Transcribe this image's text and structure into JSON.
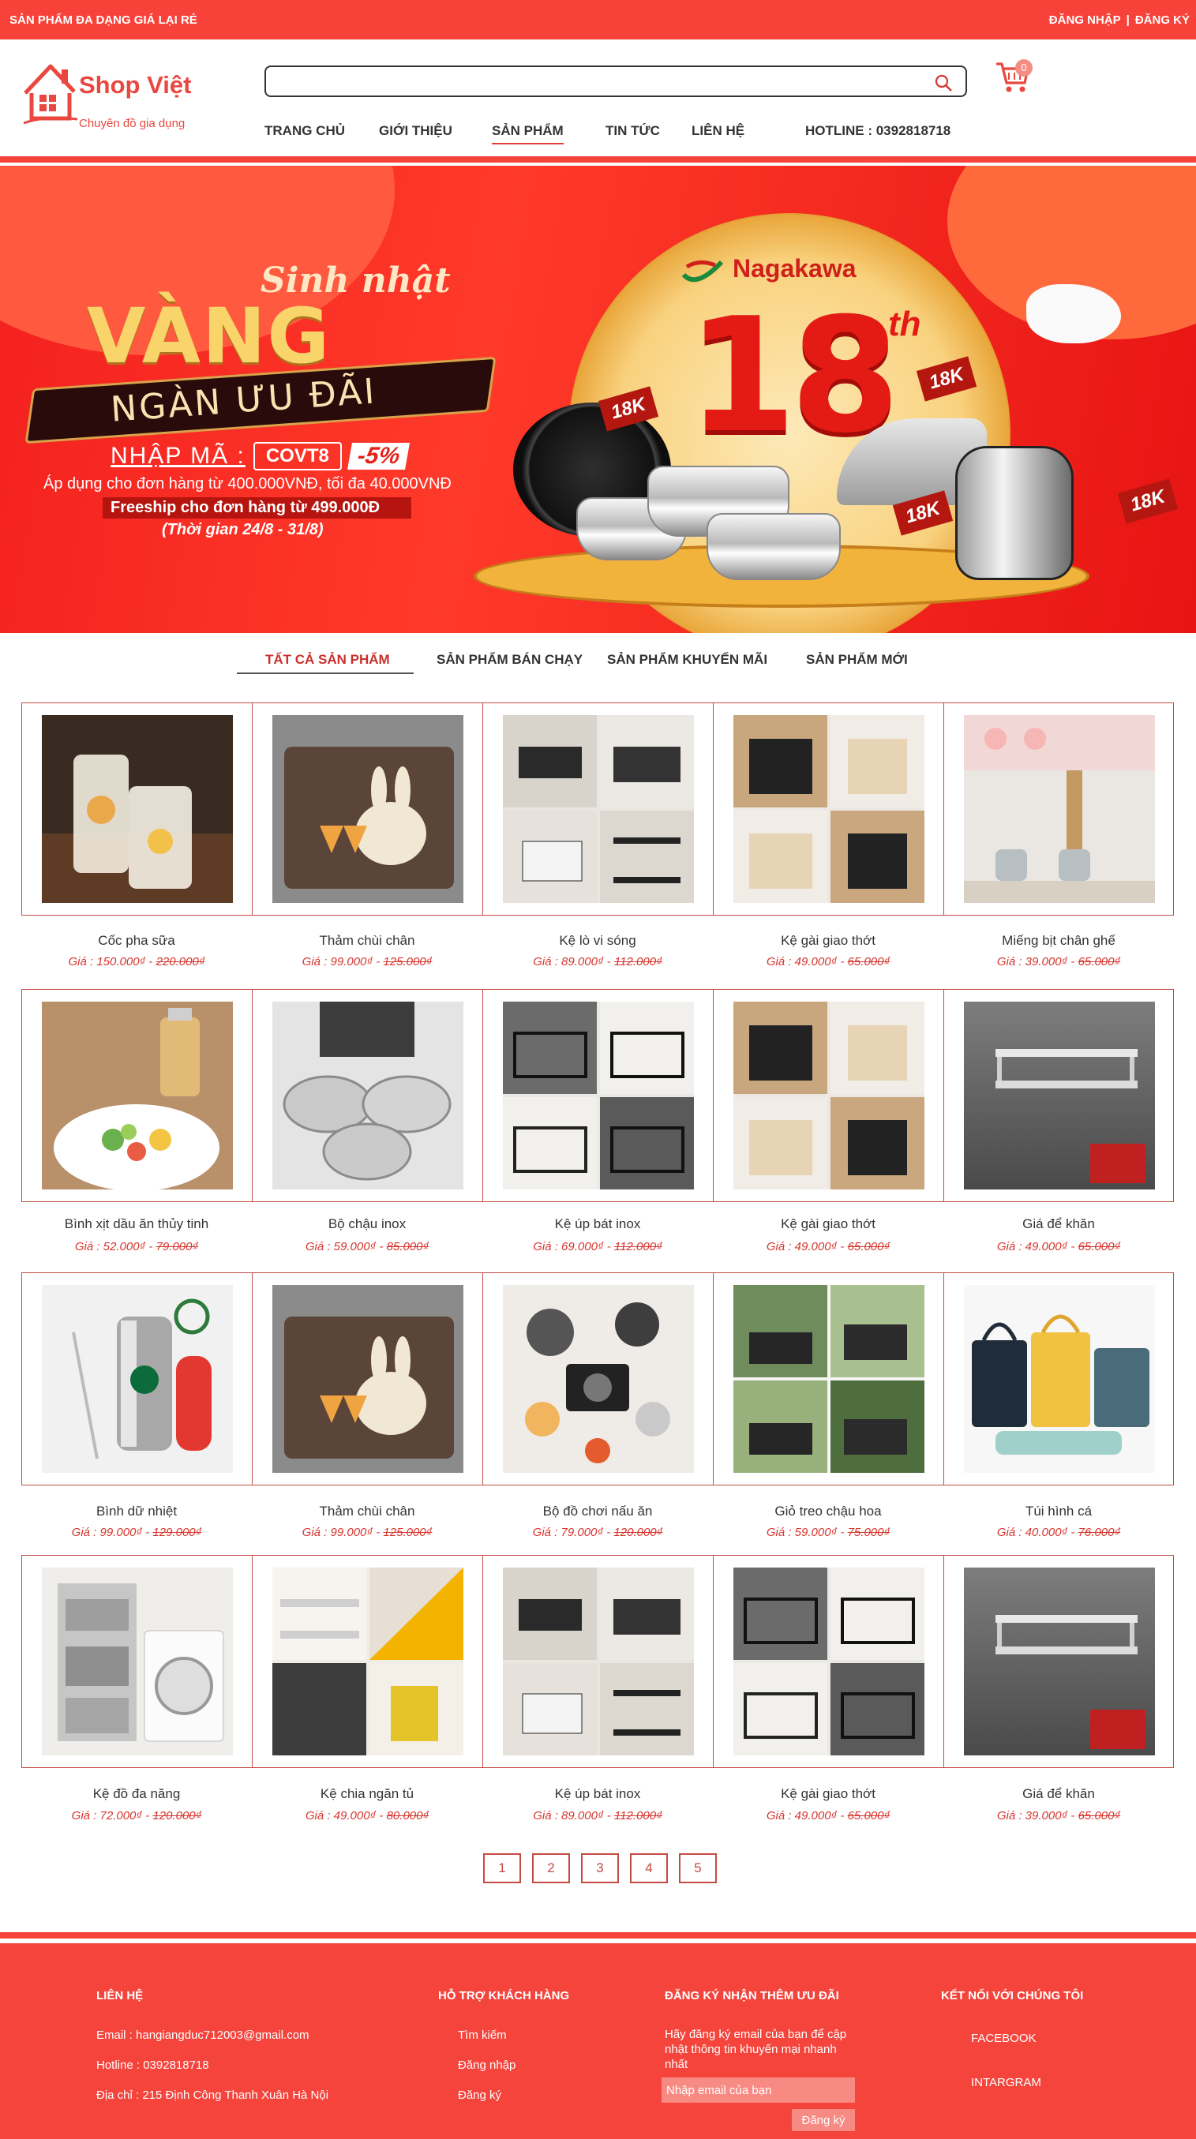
{
  "topbar": {
    "tagline": "SẢN PHẨM ĐA DẠNG GIÁ LẠI RẺ",
    "login": "ĐĂNG NHẬP",
    "separator": "|",
    "register": "ĐĂNG KÝ"
  },
  "header": {
    "brand": "Shop Việt",
    "slogan": "Chuyên đồ gia dụng",
    "search_placeholder": "",
    "cart_count": "0",
    "hotline": "HOTLINE : 0392818718",
    "nav": [
      "TRANG CHỦ",
      "GIỚI THIỆU",
      "SẢN PHẨM",
      "TIN TỨC",
      "LIÊN HỆ"
    ]
  },
  "banner": {
    "sinh_nhat": "Sinh nhật",
    "vang": "VÀNG",
    "ngan_uu_dai": "NGÀN ƯU ĐÃI",
    "code_label": "NHẬP MÃ :",
    "code": "COVT8",
    "discount": "-5%",
    "line1": "Áp dụng cho đơn hàng từ 400.000VNĐ, tối đa 40.000VNĐ",
    "line2": "Freeship cho đơn hàng từ 499.000Đ",
    "line3": "(Thời gian 24/8 - 31/8)",
    "brand": "Nagakawa",
    "big_number": "18",
    "suffix": "th",
    "tag": "18K"
  },
  "tabs": [
    "TẤT CẢ SẢN PHẨM",
    "SẢN PHẨM BÁN CHẠY",
    "SẢN PHẨM KHUYẾN MÃI",
    "SẢN PHẨM MỚI"
  ],
  "products": [
    [
      {
        "name": "Cốc pha sữa",
        "price": "Giá : 150.000₫",
        "old": "220.000₫",
        "art": "cup"
      },
      {
        "name": "Thảm chùi chân",
        "price": "Giá : 99.000₫",
        "old": "125.000₫",
        "art": "rug"
      },
      {
        "name": "Kệ lò vi sóng",
        "price": "Giá :  89.000₫",
        "old": "112.000₫",
        "art": "shelf"
      },
      {
        "name": "Kệ gài giao thớt",
        "price": "Giá : 49.000₫",
        "old": "65.000₫",
        "art": "knife"
      },
      {
        "name": "Miếng bịt chân ghế",
        "price": "Giá : 39.000₫",
        "old": "65.000₫",
        "art": "chairleg"
      }
    ],
    [
      {
        "name": "Bình xịt dầu ăn thủy tinh",
        "price": "Giá : 52.000₫",
        "old": "79.000₫",
        "art": "spray"
      },
      {
        "name": "Bộ chậu inox",
        "price": "Giá : 59.000₫",
        "old": "85.000₫",
        "art": "bowls"
      },
      {
        "name": "Kệ úp bát inox",
        "price": "Giá :  69.000₫",
        "old": "112.000₫",
        "art": "dishrack"
      },
      {
        "name": "Kệ gài giao thớt",
        "price": "Giá : 49.000₫",
        "old": "65.000₫",
        "art": "knife"
      },
      {
        "name": "Giá để khăn",
        "price": "Giá : 49.000₫",
        "old": "65.000₫",
        "art": "towel"
      }
    ],
    [
      {
        "name": "Bình dữ nhiệt",
        "price": "Giá : 99.000₫",
        "old": "129.000₫",
        "art": "flask"
      },
      {
        "name": "Thảm chùi chân",
        "price": "Giá : 99.000₫",
        "old": "125.000₫",
        "art": "rug"
      },
      {
        "name": "Bộ đồ chơi nấu ăn",
        "price": "Giá :  79.000₫",
        "old": "120.000₫",
        "art": "toys"
      },
      {
        "name": "Giỏ treo chậu hoa",
        "price": "Giá : 59.000₫",
        "old": "75.000₫",
        "art": "planter"
      },
      {
        "name": "Túi hình cá",
        "price": "Giá : 40.000₫",
        "old": "76.000₫",
        "art": "bags"
      }
    ],
    [
      {
        "name": "Kệ đồ đa năng",
        "price": "Giá : 72.000₫",
        "old": "120.000₫",
        "art": "laundry"
      },
      {
        "name": "Kệ chia ngăn tủ",
        "price": "Giá : 49.000₫",
        "old": "80.000₫",
        "art": "closet"
      },
      {
        "name": "Kệ úp bát inox",
        "price": "Giá :  89.000₫",
        "old": "112.000₫",
        "art": "shelf"
      },
      {
        "name": "Kệ gài giao thớt",
        "price": "Giá : 49.000₫",
        "old": "65.000₫",
        "art": "dishrack"
      },
      {
        "name": "Giá để khăn",
        "price": "Giá : 39.000₫",
        "old": "65.000₫",
        "art": "towel"
      }
    ]
  ],
  "price_separator": " - ",
  "pagination": [
    "1",
    "2",
    "3",
    "4",
    "5"
  ],
  "footer": {
    "contact_title": "LIÊN HỆ",
    "email": "Email : hangiangduc712003@gmail.com",
    "hotline": "Hotline : 0392818718",
    "address": "Địa chỉ : 215 Định Công Thanh Xuân Hà Nội",
    "support_title": "HỖ TRỢ KHÁCH HÀNG",
    "support_links": [
      "Tìm kiếm",
      "Đăng  nhập",
      "Đăng ký"
    ],
    "newsletter_title": "ĐĂNG KÝ NHẬN THÊM ƯU ĐÃI",
    "newsletter_text": "Hãy đăng ký email của bạn để cập nhật thông tin khuyến mại nhanh nhất",
    "email_placeholder": "Nhập email của bạn",
    "subscribe": "Đăng ký",
    "social_title": "KẾT NỐI VỚI CHÚNG TÔI",
    "social_links": [
      "FACEBOOK",
      "INTARGRAM"
    ]
  },
  "colors": {
    "primary_red": "#f7423a",
    "accent_red": "#d6352e",
    "border": "#c44a44"
  }
}
